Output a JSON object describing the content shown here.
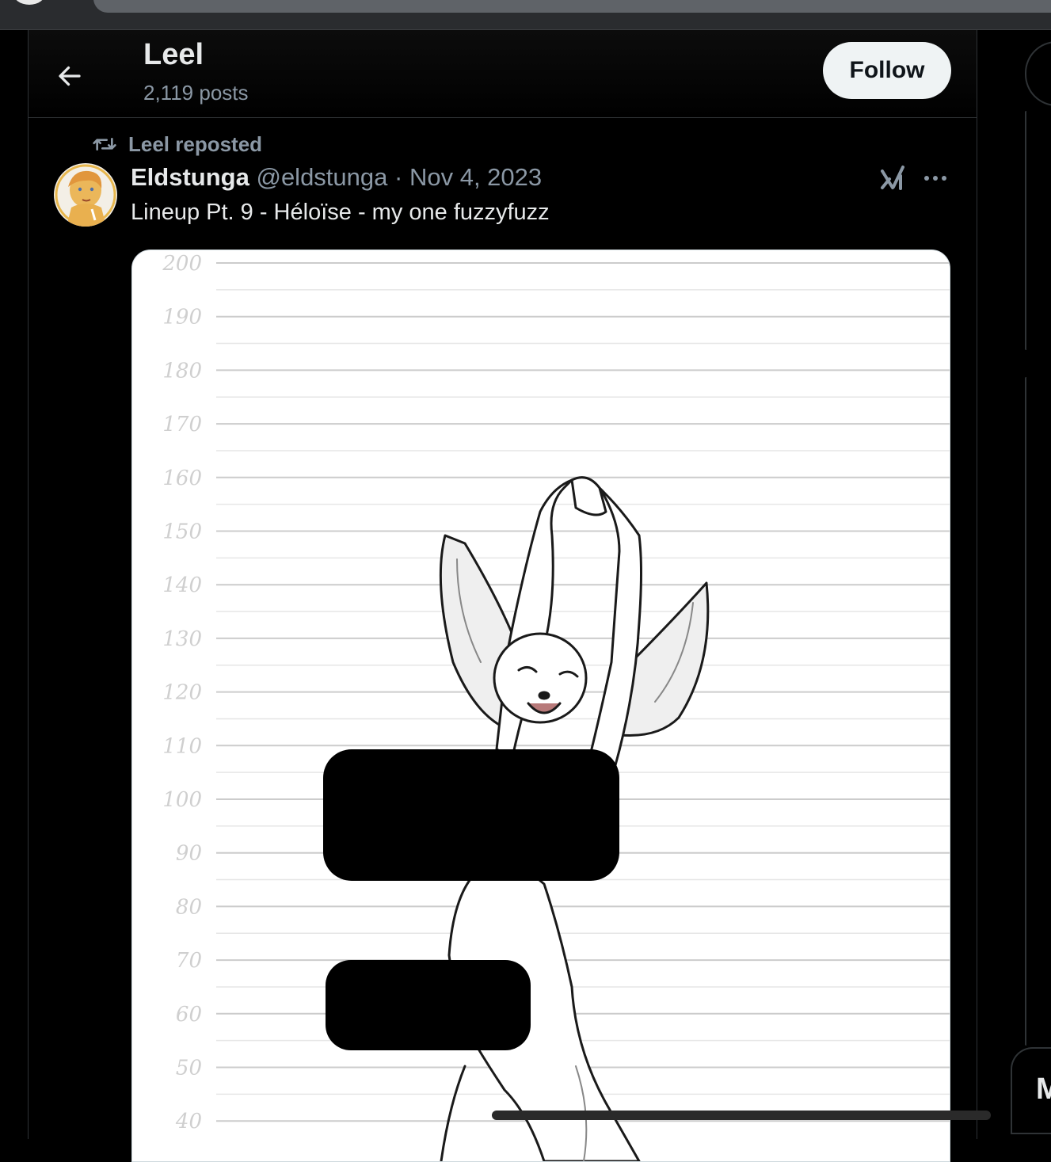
{
  "header": {
    "title": "Leel",
    "posts_count": "2,119 posts",
    "follow_label": "Follow"
  },
  "post": {
    "repost_label": "Leel reposted",
    "author_name": "Eldstunga",
    "author_handle": "@eldstunga",
    "separator": "·",
    "date": "Nov 4, 2023",
    "text": "Lineup Pt. 9 - Héloïse - my one fuzzyfuzz",
    "media": {
      "height_scale_labels": [
        "200",
        "190",
        "180",
        "170",
        "160",
        "150",
        "140",
        "130",
        "120",
        "110",
        "100",
        "90",
        "80",
        "70",
        "60",
        "50",
        "40"
      ]
    }
  },
  "sidebar": {
    "message_button_label": "M"
  },
  "icons": {
    "back": "arrow-left-icon",
    "repost": "repost-icon",
    "grok": "grok-icon",
    "more": "more-horizontal-icon"
  },
  "colors": {
    "background": "#000000",
    "text_primary": "#e7e9ea",
    "text_secondary": "#8b98a5",
    "follow_bg": "#eff3f4",
    "border": "#2f3336"
  }
}
